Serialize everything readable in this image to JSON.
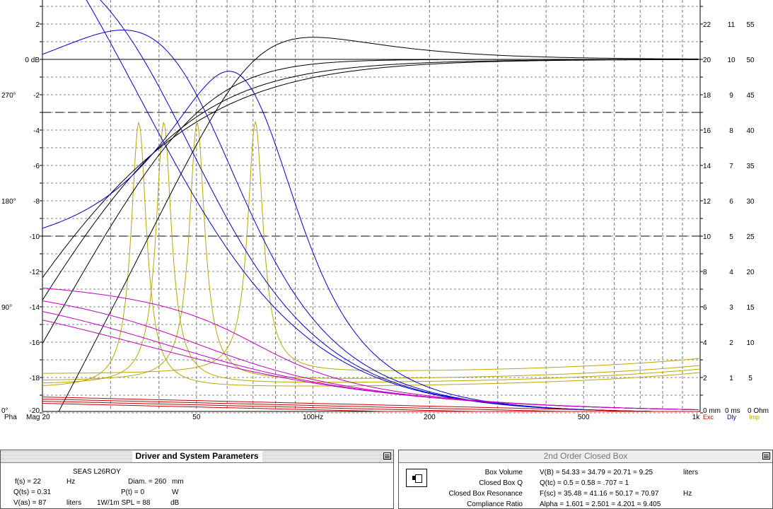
{
  "plot": {
    "left_axis": {
      "db_ticks": [
        "2",
        "0 dB",
        "-2",
        "-4",
        "-6",
        "-8",
        "-10",
        "-12",
        "-14",
        "-16",
        "-18",
        "-20"
      ],
      "phase_ticks": [
        "270°",
        "180°",
        "90°",
        "0°"
      ],
      "phase_label": "Pha",
      "mag_label": "Mag"
    },
    "x_axis": {
      "ticks": [
        "20",
        "50",
        "100Hz",
        "200",
        "500",
        "1k"
      ]
    },
    "right_axis": {
      "col1": [
        "22",
        "20",
        "18",
        "16",
        "14",
        "12",
        "10",
        "8",
        "6",
        "4",
        "2",
        "0 mm"
      ],
      "col2": [
        "11",
        "10",
        "9",
        "8",
        "7",
        "6",
        "5",
        "4",
        "3",
        "2",
        "1",
        "0 ms"
      ],
      "col3": [
        "55",
        "50",
        "45",
        "40",
        "35",
        "30",
        "25",
        "20",
        "15",
        "10",
        "5",
        "0 Ohm"
      ],
      "legend": {
        "exc": "Exc",
        "dly": "Dly",
        "imp": "Imp"
      }
    },
    "colors": {
      "phase": "#c000c0",
      "mag": "#000000",
      "excursion": "#cc0000",
      "delay": "#0000cc",
      "impedance": "#b8a800"
    },
    "chart_data": {
      "type": "line",
      "xlabel": "",
      "ylabel": "",
      "x_scale": "log",
      "xlim": [
        20,
        1000
      ],
      "ylim": [
        -20,
        3
      ],
      "markers_db": [
        0,
        -3,
        -10
      ],
      "series_mag": [
        {
          "points": [
            [
              20,
              -20
            ],
            [
              40,
              -8
            ],
            [
              60,
              -2.4
            ],
            [
              80,
              0.5
            ],
            [
              100,
              1.3
            ],
            [
              150,
              0.9
            ],
            [
              200,
              0.5
            ],
            [
              500,
              0.1
            ],
            [
              1000,
              0
            ]
          ]
        },
        {
          "points": [
            [
              20,
              -16
            ],
            [
              30,
              -9.5
            ],
            [
              50,
              -4
            ],
            [
              70,
              -1.6
            ],
            [
              100,
              -0.8
            ],
            [
              200,
              -0.2
            ],
            [
              1000,
              0
            ]
          ]
        },
        {
          "points": [
            [
              20,
              -14.5
            ],
            [
              30,
              -8.5
            ],
            [
              50,
              -4
            ],
            [
              70,
              -2
            ],
            [
              100,
              -1
            ],
            [
              200,
              -0.4
            ],
            [
              1000,
              0
            ]
          ]
        },
        {
          "points": [
            [
              20,
              -13.5
            ],
            [
              30,
              -8
            ],
            [
              50,
              -3.9
            ],
            [
              70,
              -2.2
            ],
            [
              100,
              -1.3
            ],
            [
              200,
              -0.5
            ],
            [
              1000,
              0
            ]
          ]
        }
      ],
      "series_impedance_ohm": [
        {
          "fc": 35.48,
          "peak": 41,
          "base": 3.5
        },
        {
          "fc": 41.16,
          "peak": 41,
          "base": 4
        },
        {
          "fc": 50.17,
          "peak": 41,
          "base": 4.5
        },
        {
          "fc": 70.97,
          "peak": 41,
          "base": 5.5
        }
      ]
    }
  },
  "driver_window": {
    "title": "Driver and System Parameters",
    "driver_name": "SEAS  L26ROY",
    "rows": [
      {
        "label": "f(s) = 22",
        "unit": "Hz",
        "label2": "Diam. = 260",
        "unit2": "mm"
      },
      {
        "label": "Q(ts) = 0.31",
        "unit": "",
        "label2": "P(t) = 0",
        "unit2": "W"
      },
      {
        "label": "V(as) = 87",
        "unit": "liters",
        "label2": "1W/1m SPL = 88",
        "unit2": "dB"
      }
    ]
  },
  "box_window": {
    "title": "2nd Order Closed Box",
    "rows": [
      {
        "label": "Box Volume",
        "value": "V(B) = 54.33  = 34.79  = 20.71  = 9.25",
        "unit": "liters"
      },
      {
        "label": "Closed Box Q",
        "value": "Q(tc) = 0.5      = 0.58    = .707     = 1",
        "unit": ""
      },
      {
        "label": "Closed Box Resonance",
        "value": "F(sc) = 35.48  = 41.16  = 50.17  = 70.97",
        "unit": "Hz"
      },
      {
        "label": "Compliance Ratio",
        "value": "Alpha = 1.601  = 2.501  = 4.201  = 9.405",
        "unit": ""
      }
    ]
  }
}
